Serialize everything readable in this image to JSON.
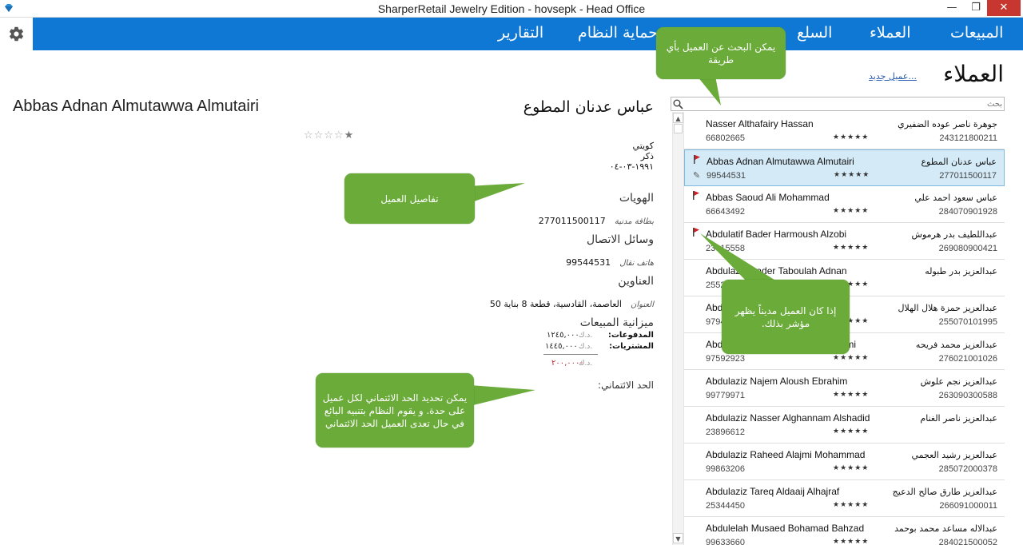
{
  "window": {
    "title": "SharperRetail Jewelry Edition - hovsepk - Head Office",
    "min_glyph": "—",
    "max_glyph": "❐",
    "close_glyph": "✕"
  },
  "nav": {
    "items": [
      "المبيعات",
      "العملاء",
      "السلع",
      "حماية النظام",
      "التقارير"
    ]
  },
  "customers": {
    "heading": "العملاء",
    "new_link": "عميل جديد...",
    "search_placeholder": "بحث",
    "list": [
      {
        "name_en": "Nasser Althafairy Hassan",
        "name_ar": "جوهرة ناصر عوده الضفيري",
        "phone": "66802665",
        "civil_id": "243121800211",
        "stars": "★★★★★",
        "flagged": false,
        "selected": false
      },
      {
        "name_en": "Abbas Adnan Almutawwa Almutairi",
        "name_ar": "عباس عدنان المطوع",
        "phone": "99544531",
        "civil_id": "277011500117",
        "stars": "★★★★★",
        "flagged": true,
        "selected": true
      },
      {
        "name_en": "Abbas Saoud Ali Mohammad",
        "name_ar": "عباس سعود احمد علي",
        "phone": "66643492",
        "civil_id": "284070901928",
        "stars": "★★★★★",
        "flagged": true,
        "selected": false
      },
      {
        "name_en": "Abdulatif Bader Harmoush Alzobi",
        "name_ar": "عبداللطيف بدر هرموش",
        "phone": "23915558",
        "civil_id": "269080900421",
        "stars": "★★★★★",
        "flagged": true,
        "selected": false
      },
      {
        "name_en": "Abdulaziz Bader Taboulah Adnan",
        "name_ar": "عبدالعزيز بدر طبوله",
        "phone": "25526789",
        "civil_id": "",
        "stars": "★★★★★",
        "flagged": false,
        "selected": false
      },
      {
        "name_en": "Abdulaziz Hamza Hilal Alhilal",
        "name_ar": "عبدالعزيز حمزة هلال الهلال",
        "phone": "97941211",
        "civil_id": "255070101995",
        "stars": "★★★★★",
        "flagged": false,
        "selected": false
      },
      {
        "name_en": "Abdulaziz Mohammad Frieh Alazmi",
        "name_ar": "عبدالعزيز محمد فريحه",
        "phone": "97592923",
        "civil_id": "276021001026",
        "stars": "★★★★★",
        "flagged": false,
        "selected": false
      },
      {
        "name_en": "Abdulaziz Najem Aloush Ebrahim",
        "name_ar": "عبدالعزيز نجم علوش",
        "phone": "99779971",
        "civil_id": "263090300588",
        "stars": "★★★★★",
        "flagged": false,
        "selected": false
      },
      {
        "name_en": "Abdulaziz Nasser Alghannam Alshadid",
        "name_ar": "عبدالعزيز ناصر الغنام",
        "phone": "23896612",
        "civil_id": "",
        "stars": "★★★★★",
        "flagged": false,
        "selected": false
      },
      {
        "name_en": "Abdulaziz Raheed Alajmi Mohammad",
        "name_ar": "عبدالعزيز رشيد العجمي",
        "phone": "99863206",
        "civil_id": "285072000378",
        "stars": "★★★★★",
        "flagged": false,
        "selected": false
      },
      {
        "name_en": "Abdulaziz Tareq Aldaaij Alhajraf",
        "name_ar": "عبدالعزيز طارق صالح الدعيج",
        "phone": "25344450",
        "civil_id": "266091000011",
        "stars": "★★★★★",
        "flagged": false,
        "selected": false
      },
      {
        "name_en": "Abdulelah Musaed Bohamad Bahzad",
        "name_ar": "عبدالاله مساعد محمد بوحمد",
        "phone": "99633660",
        "civil_id": "284021500052",
        "stars": "★★★★★",
        "flagged": false,
        "selected": false
      }
    ]
  },
  "detail": {
    "name_en": "Abbas Adnan Almutawwa Almutairi",
    "name_ar": "عباس عدنان المطوع",
    "rating_empty": "☆☆☆☆",
    "rating_filled": "★",
    "nationality": "كويتي",
    "gender": "ذكر",
    "dob": "١٩٩١-٠٣-٠٤",
    "ids_heading": "الهويات",
    "id_label": "بطاقة مدنية",
    "id_value": "277011500117",
    "contact_heading": "وسائل الاتصال",
    "phone_label": "هاتف نقال",
    "phone_value": "99544531",
    "address_heading": "العناوين",
    "address_label": "العنوان",
    "address_value": "العاصمة، القادسية، قطعة 8 بناية 50",
    "sales_heading": "ميزانية المبيعات",
    "payments_label": "المدفوعات:",
    "purchases_label": "المشتريات:",
    "currency": "د.ك.",
    "payments_value": "١٢٤٥,٠٠٠",
    "purchases_value": "١٤٤٥,٠٠٠",
    "balance_value": "٢٠٠,٠٠٠-",
    "credit_limit_label": "الحد الائتماني:"
  },
  "callouts": {
    "search_tip": "يمكن البحث عن العميل بأي طريقة",
    "details_tip": "تفاصيل العميل",
    "flag_tip": "إذا كان العميل مديناً يظهر مؤشر بذلك.",
    "credit_tip": "يمكن تحديد الحد الائتماني لكل عميل على حدة. و يقوم النظام بتنبيه البائع في حال تعدى العميل الحد الائتماني"
  },
  "colors": {
    "nav_bg": "#0f78d4",
    "callout_bg": "#6aab3a",
    "selected_row": "#d4eaf7",
    "flag": "#d0222a",
    "negative": "#c0262f"
  }
}
